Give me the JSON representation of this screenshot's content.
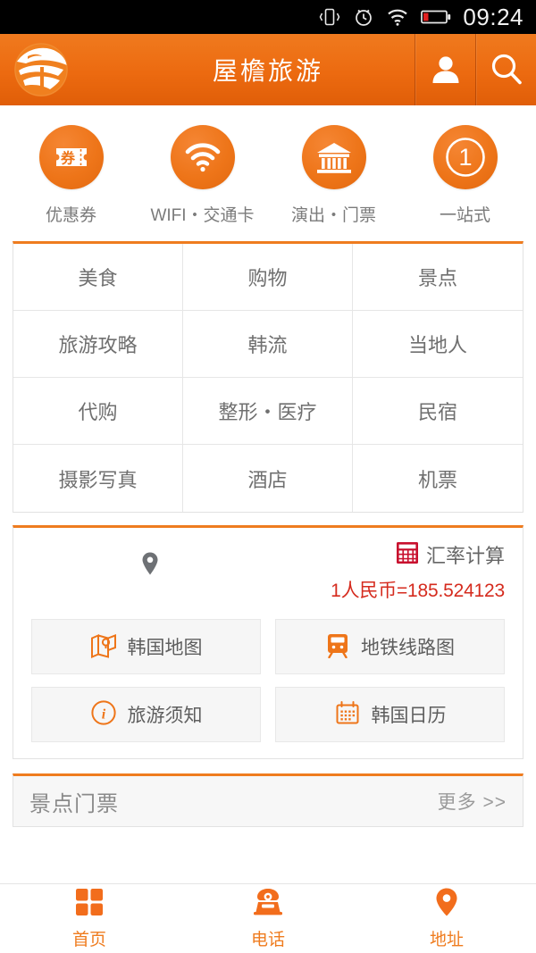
{
  "statusbar": {
    "icons": [
      "vibrate-icon",
      "alarm-icon",
      "wifi-icon",
      "battery-low-icon"
    ],
    "time": "09:24"
  },
  "header": {
    "logo_icon": "eaves-logo-icon",
    "title": "屋檐旅游",
    "user_icon": "user-icon",
    "search_icon": "search-icon",
    "brand_color": "#ee7519"
  },
  "quick_actions": [
    {
      "label": "优惠券",
      "icon": "coupon-ticket-icon"
    },
    {
      "label": "WIFI・交通卡",
      "icon": "wifi-icon"
    },
    {
      "label": "演出・门票",
      "icon": "temple-building-icon"
    },
    {
      "label": "一站式",
      "icon": "number-one-circle-icon"
    }
  ],
  "category_grid": {
    "cells": [
      "美食",
      "购物",
      "景点",
      "旅游攻略",
      "韩流",
      "当地人",
      "代购",
      "整形・医疗",
      "民宿",
      "摄影写真",
      "酒店",
      "机票"
    ]
  },
  "rate_panel": {
    "location_icon": "map-pin-icon",
    "calculator_icon": "calculator-icon",
    "calculator_color": "#c8102e",
    "title": "汇率计算",
    "value": "1人民币=185.524123",
    "value_color": "#d52b1e"
  },
  "tool_buttons": [
    {
      "label": "韩国地图",
      "icon": "folded-map-icon"
    },
    {
      "label": "地铁线路图",
      "icon": "subway-train-icon"
    },
    {
      "label": "旅游须知",
      "icon": "info-circle-icon"
    },
    {
      "label": "韩国日历",
      "icon": "calendar-icon"
    }
  ],
  "tickets_section": {
    "title": "景点门票",
    "more_label": "更多 >>"
  },
  "bottom_nav": [
    {
      "label": "首页",
      "icon": "grid-home-icon"
    },
    {
      "label": "电话",
      "icon": "telephone-icon"
    },
    {
      "label": "地址",
      "icon": "map-pin-icon"
    }
  ]
}
